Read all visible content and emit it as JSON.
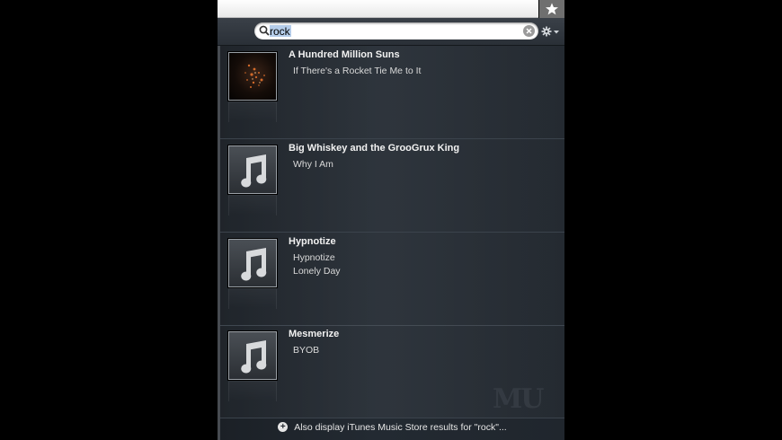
{
  "search": {
    "value": "rock"
  },
  "results": [
    {
      "album": "A Hundred Million Suns",
      "tracks": [
        "If There's a Rocket Tie Me to It"
      ],
      "artwork": "album-cover"
    },
    {
      "album": "Big Whiskey and the GrooGrux King",
      "tracks": [
        "Why I Am"
      ],
      "artwork": "music-note-icon"
    },
    {
      "album": "Hypnotize",
      "tracks": [
        "Hypnotize",
        "Lonely Day"
      ],
      "artwork": "music-note-icon"
    },
    {
      "album": "Mesmerize",
      "tracks": [
        "BYOB"
      ],
      "artwork": "music-note-icon"
    }
  ],
  "footer": {
    "label": "Also display iTunes Music Store results for \"rock\"..."
  },
  "watermark": "MU",
  "icons": {
    "menubar": "star-icon",
    "search": "magnifier-icon",
    "clear": "clear-x-icon",
    "options": "gear-icon",
    "footer": "plus-circle-icon"
  }
}
